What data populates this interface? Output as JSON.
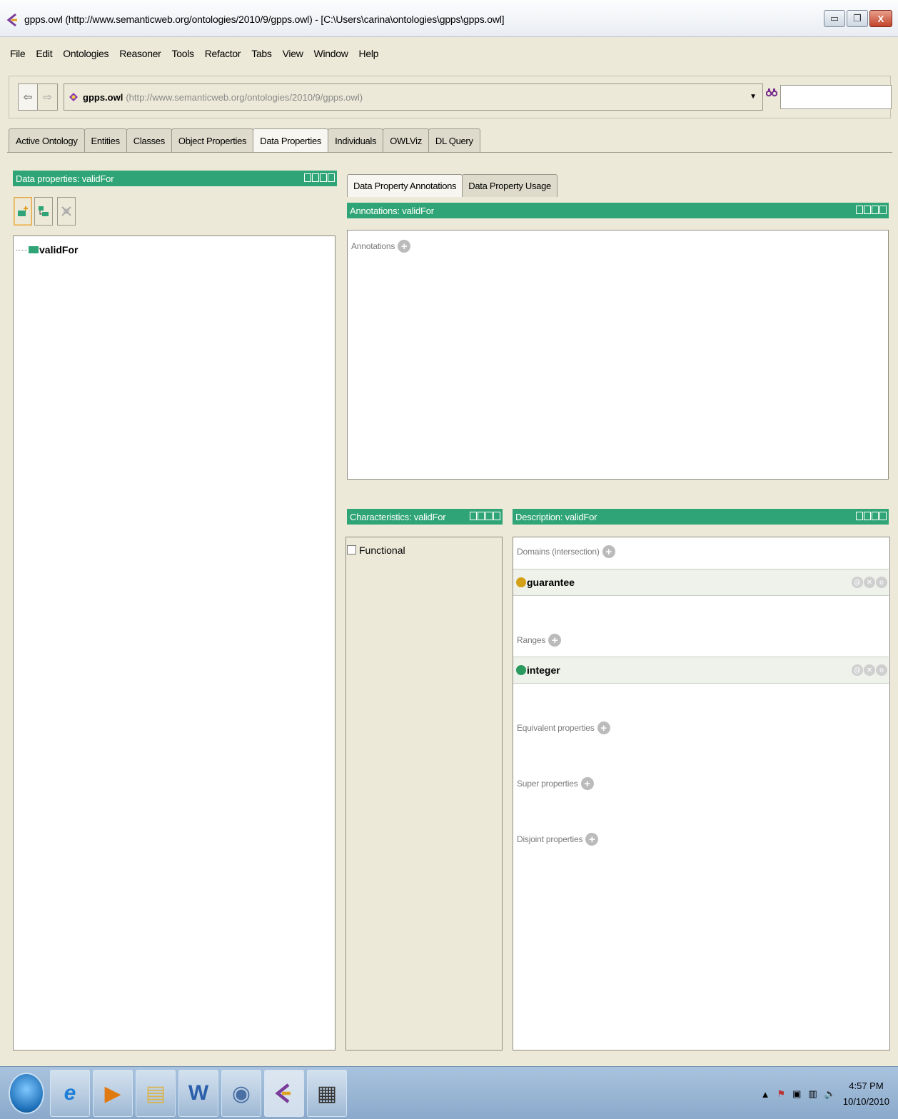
{
  "window": {
    "title": "gpps.owl (http://www.semanticweb.org/ontologies/2010/9/gpps.owl) - [C:\\Users\\carina\\ontologies\\gpps\\gpps.owl]",
    "minimize_glyph": "▭",
    "restore_glyph": "❐",
    "close_glyph": "X"
  },
  "menu": [
    "File",
    "Edit",
    "Ontologies",
    "Reasoner",
    "Tools",
    "Refactor",
    "Tabs",
    "View",
    "Window",
    "Help"
  ],
  "address": {
    "ontology_name": "gpps.owl",
    "ontology_uri": "(http://www.semanticweb.org/ontologies/2010/9/gpps.owl)",
    "back_glyph": "⇦",
    "forward_glyph": "⇨",
    "search_glyph": "ꟸ",
    "search_value": ""
  },
  "tabs": [
    "Active Ontology",
    "Entities",
    "Classes",
    "Object Properties",
    "Data Properties",
    "Individuals",
    "OWLViz",
    "DL Query"
  ],
  "active_tab": "Data Properties",
  "hierarchy_view": {
    "header": "Data properties: validFor",
    "items": [
      {
        "label": "validFor"
      }
    ]
  },
  "annotation_tabs": [
    "Data Property Annotations",
    "Data Property Usage"
  ],
  "annotations_view": {
    "header": "Annotations: validFor",
    "section_label": "Annotations"
  },
  "characteristics_view": {
    "header": "Characteristics: validFor",
    "functional_label": "Functional",
    "functional_checked": false
  },
  "description_view": {
    "header": "Description: validFor",
    "domains_label": "Domains (intersection)",
    "domain_value": "guarantee",
    "ranges_label": "Ranges",
    "range_value": "integer",
    "equivalent_label": "Equivalent properties",
    "super_label": "Super properties",
    "disjoint_label": "Disjoint properties"
  },
  "taskbar": {
    "time": "4:57 PM",
    "date": "10/10/2010"
  },
  "colors": {
    "view_header": "#2fa577",
    "class_bullet": "#d4a017",
    "datatype_bullet": "#2a9a5e",
    "taskbar": "#9ab6d6"
  }
}
